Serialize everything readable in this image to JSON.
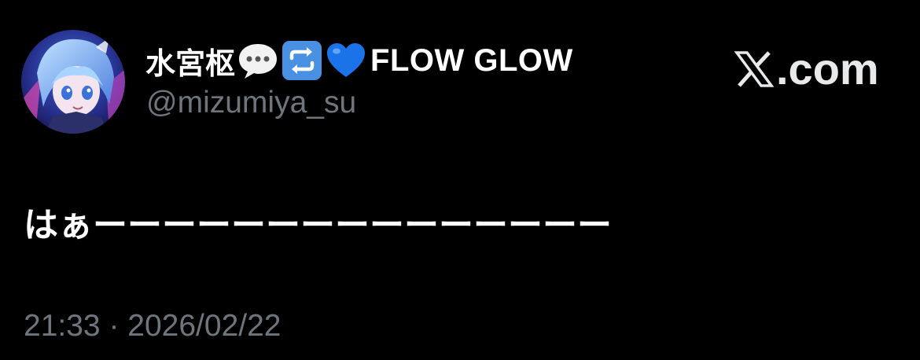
{
  "tweet": {
    "display_name": "水宮枢",
    "name_emojis": [
      "speech-bubble-emoji",
      "repeat-emoji",
      "blue-heart-emoji"
    ],
    "name_suffix": "FLOW GLOW",
    "handle": "@mizumiya_su",
    "text": "はぁーーーーーーーーーーーーーーー",
    "time": "21:33",
    "separator": "·",
    "date": "2026/02/22"
  },
  "brand": {
    "logo": "x-logo",
    "domain_suffix": ".com"
  },
  "colors": {
    "background": "#000000",
    "primary_text": "#ffffff",
    "secondary_text": "#6e767d",
    "emoji_blue": "#4a90e2"
  }
}
